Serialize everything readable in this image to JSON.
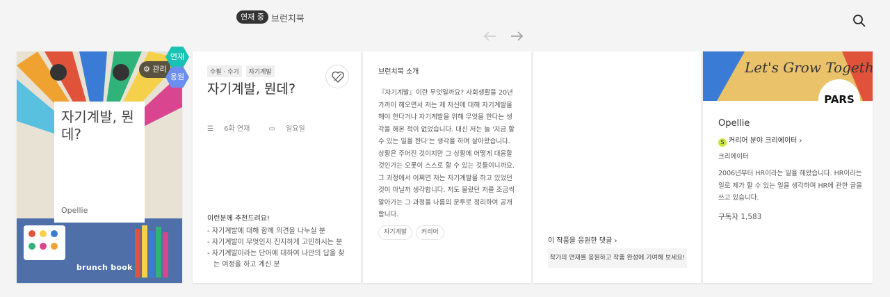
{
  "header": {
    "status_badge": "연재 중",
    "book_title": "브런치북"
  },
  "cover": {
    "title": "자기계발, 뭔데?",
    "author": "Opellie",
    "brand": "brunch book",
    "manage_label": "관리",
    "tab_serial": "연재",
    "tab_support": "응원",
    "colors": {
      "serial_tab": "#18c3b5",
      "support_tab": "#6c8ef0"
    }
  },
  "book_info": {
    "tags": [
      "수필 · 수기",
      "자기계발"
    ],
    "title": "자기계발, 뭔데?",
    "episodes": "6화 연재",
    "day": "일요일",
    "recommend_heading": "이런분께 추천드려요!",
    "recommend_items": [
      "자기계발에 대해 함께 의견을 나누실 분",
      "자기계발이 무엇인지 진지하게 고민하시는 분",
      "자기계발이라는 단어에 대하여 나만의 답을 찾는 여정을 하고 계신 분"
    ]
  },
  "intro": {
    "heading": "브런치북 소개",
    "body": "『자기계발』이란 무엇일까요? 사회생활을 20년 가까이 해오면서 저는 제 자신에 대해 자기계발을 해야 한다거나 자기계발을 위해 무엇을 한다는 생각을 해본 적이 없었습니다. 대신 저는 늘 '지금 할 수 있는 일을 한다'는 생각을 하며 살아왔습니다. 상황은 주어진 것이지만 그 상황에 어떻게 대응할 것인가는 오롯이 스스로 할 수 있는 것들이니까요. 그 과정에서 어쩌면 저는 자기계발을 하고 있었던 것이 아닐까 생각합니다. 저도 몰랐던 저를 조금씩 알아가는 그 과정을 나름의 문투로 정리하여 공개합니다.",
    "keywords": [
      "자기계발",
      "커리어"
    ]
  },
  "comments": {
    "heading": "이 작품을 응원한 댓글",
    "prompt": "작가의 연재를 응원하고 작품 완성에 기여해 보세요!"
  },
  "writer": {
    "banner_text": "Let's Grow Together",
    "avatar_text": "PARS",
    "name": "Opellie",
    "role": "커리어 분야 크리에이터",
    "role_badge": "S",
    "type": "크리에이터",
    "description": "2006년부터 HR이라는 일을 해왔습니다. HR이라는 일로 제가 할 수 있는 일을 생각하며 HR에 관한 글을 쓰고 있습니다.",
    "subscribers": "구독자 1,583"
  },
  "icons": [
    "search-icon",
    "arrow-left-icon",
    "arrow-right-icon",
    "gear-icon",
    "heart-icon",
    "list-icon",
    "calendar-icon",
    "chevron-right-icon"
  ]
}
